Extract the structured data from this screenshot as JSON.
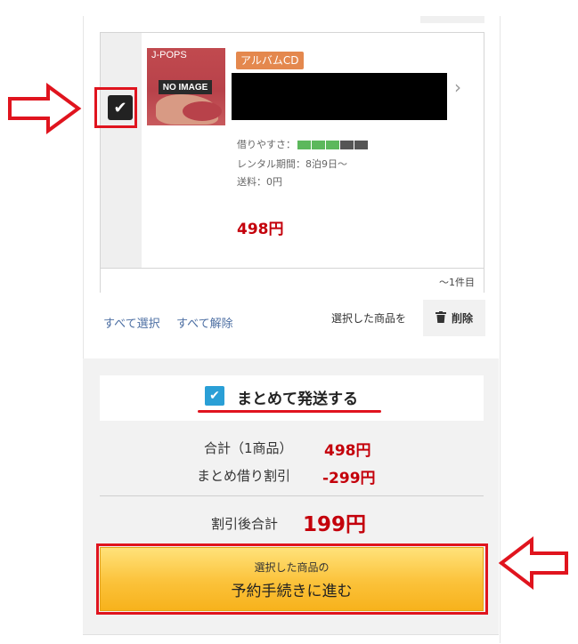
{
  "cart_item": {
    "genre": "J-POPS",
    "no_image": "NO IMAGE",
    "format_badge": "アルバムCD",
    "ease_label": "借りやすさ：",
    "ease_level": 3,
    "ease_max": 5,
    "rental_period": "レンタル期間：8泊9日〜",
    "shipping": "送料：0円",
    "price": "498円",
    "count": "〜1件目"
  },
  "selection": {
    "select_all": "すべて選択",
    "deselect_all": "すべて解除",
    "selected_label": "選択した商品を",
    "delete": "削除"
  },
  "summary": {
    "bundle_label": "まとめて発送する",
    "subtotal_label": "合計（1商品）",
    "subtotal_value": "498円",
    "discount_label": "まとめ借り割引",
    "discount_value": "-299円",
    "total_label": "割引後合計",
    "total_value": "199円"
  },
  "cta": {
    "sub": "選択した商品の",
    "main": "予約手続きに進む"
  },
  "colors": {
    "price_red": "#c4000b",
    "highlight_red": "#e0141e",
    "check_blue": "#2a9fd6",
    "ease_on": "#5cb85c",
    "ease_off": "#555555"
  },
  "icons": [
    "check-icon",
    "chevron-right-icon",
    "trash-icon",
    "arrow-right-icon",
    "arrow-left-icon"
  ]
}
